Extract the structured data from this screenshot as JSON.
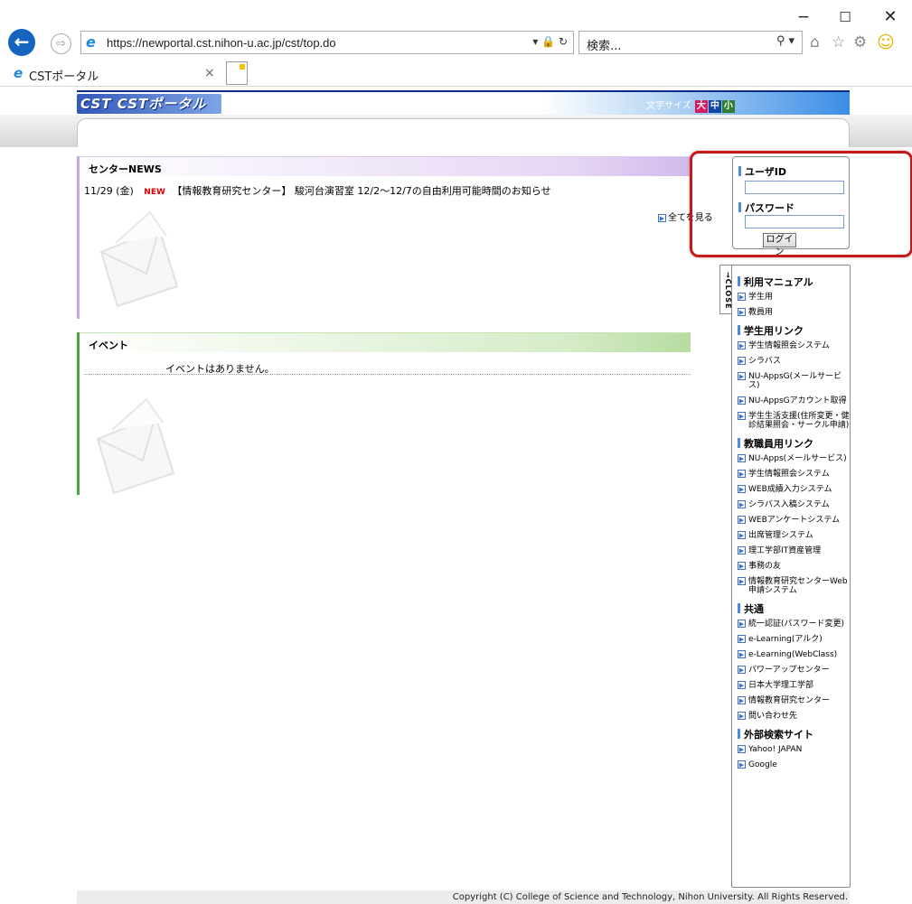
{
  "browser": {
    "url": "https://newportal.cst.nihon-u.ac.jp/cst/top.do",
    "search_placeholder": "検索...",
    "tab_title": "CSTポータル",
    "back_icon": "back-arrow-icon",
    "forward_icon": "forward-arrow-icon"
  },
  "header": {
    "logo_text": "CST CSTポータル",
    "font_size_label": "文字サイズ",
    "font_size_large": "大",
    "font_size_medium": "中",
    "font_size_small": "小"
  },
  "news": {
    "title": "センターNEWS",
    "items": [
      {
        "date": "11/29 (金)",
        "badge": "NEW",
        "text": "【情報教育研究センター】 駿河台演習室 12/2〜12/7の自由利用可能時間のお知らせ"
      }
    ],
    "see_all": "全てを見る"
  },
  "events": {
    "title": "イベント",
    "empty_message": "イベントはありません。"
  },
  "login": {
    "user_id_label": "ユーザID",
    "password_label": "パスワード",
    "login_button": "ログイン"
  },
  "sidebar": {
    "close_label": "CLOSE",
    "sections": [
      {
        "title": "利用マニュアル",
        "links": [
          "学生用",
          "教員用"
        ]
      },
      {
        "title": "学生用リンク",
        "links": [
          "学生情報照会システム",
          "シラバス",
          "NU-AppsG(メールサービス)",
          "NU-AppsGアカウント取得",
          "学生生活支援(住所変更・健診結果照会・サークル申請)"
        ]
      },
      {
        "title": "教職員用リンク",
        "links": [
          "NU-Apps(メールサービス)",
          "学生情報照会システム",
          "WEB成績入力システム",
          "シラバス入稿システム",
          "WEBアンケートシステム",
          "出席管理システム",
          "理工学部IT資産管理",
          "事務の友",
          "情報教育研究センターWeb申請システム"
        ]
      },
      {
        "title": "共通",
        "links": [
          "統一認証(パスワード変更)",
          "e-Learning(アルク)",
          "e-Learning(WebClass)",
          "パワーアップセンター",
          "日本大学理工学部",
          "情報教育研究センター",
          "問い合わせ先"
        ]
      },
      {
        "title": "外部検索サイト",
        "links": [
          "Yahoo! JAPAN",
          "Google"
        ]
      }
    ]
  },
  "footer": {
    "copyright": "Copyright (C) College of Science and Technology, Nihon University. All Rights Reserved."
  }
}
